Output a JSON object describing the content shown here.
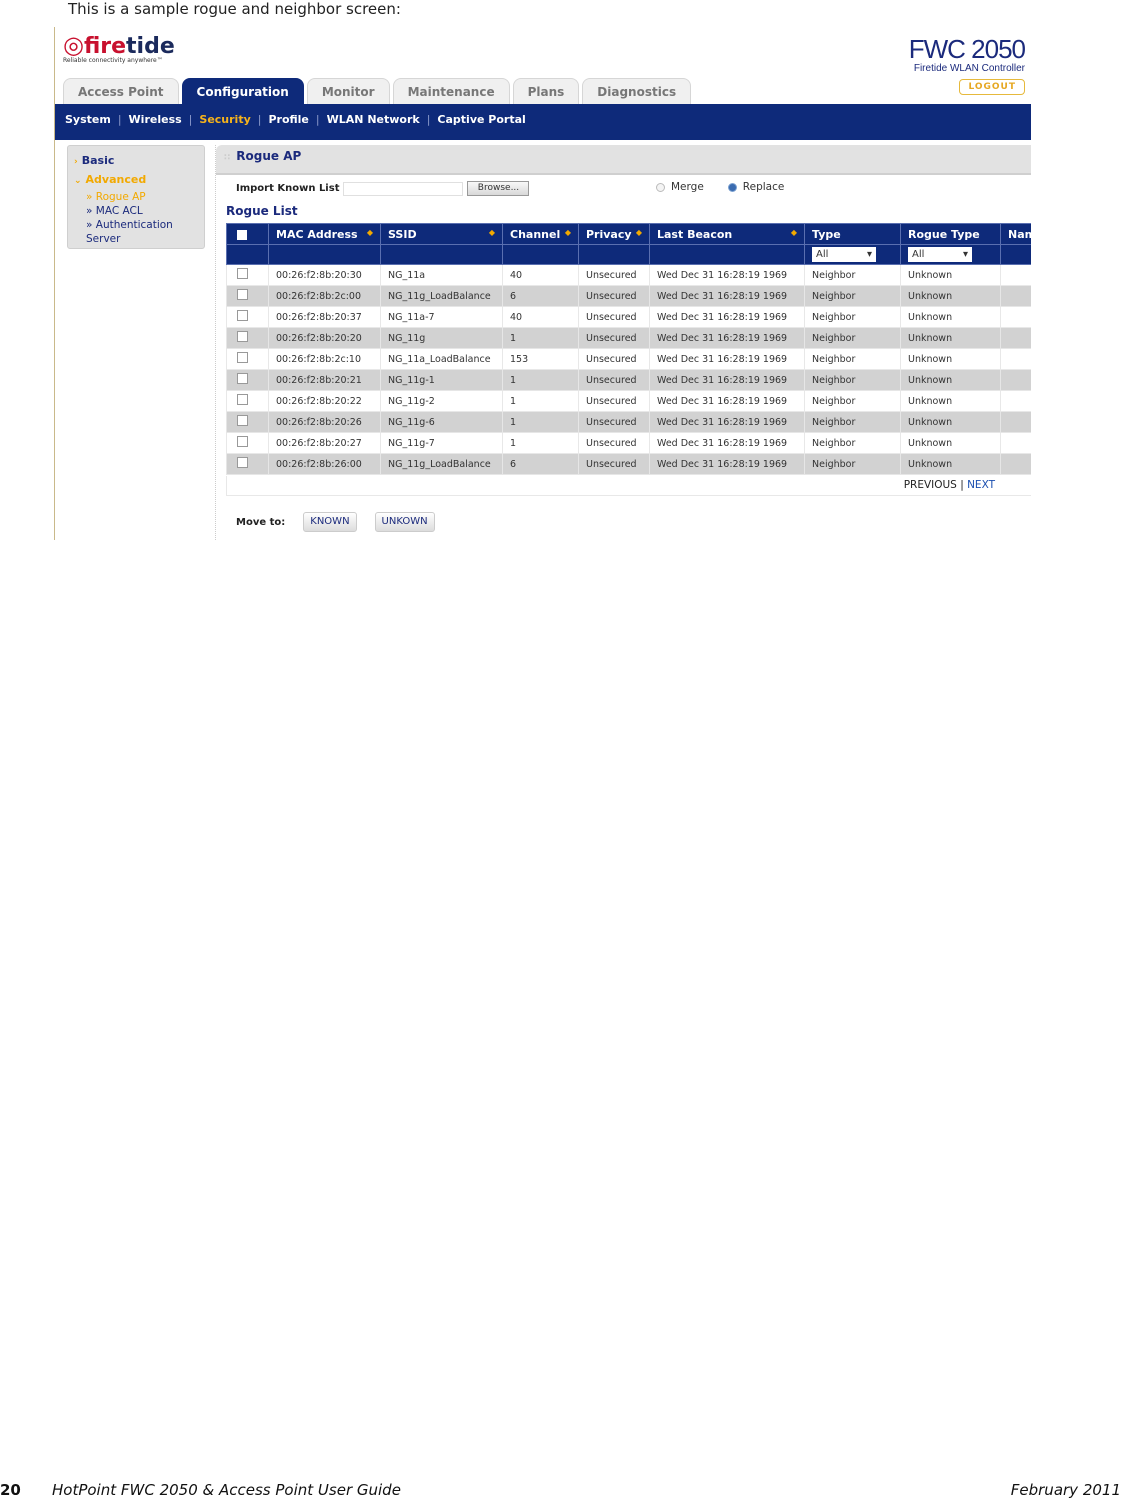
{
  "intro_text": "This is a sample rogue and neighbor screen:",
  "logo": {
    "mark": "୯",
    "fire": "fire",
    "tide": "tide",
    "tagline": "Reliable connectivity anywhere™"
  },
  "brand": {
    "model": "FWC 2050",
    "subtitle": "Firetide WLAN Controller",
    "logout_label": "LOGOUT"
  },
  "tabs": [
    {
      "label": "Access Point",
      "active": false
    },
    {
      "label": "Configuration",
      "active": true
    },
    {
      "label": "Monitor",
      "active": false
    },
    {
      "label": "Maintenance",
      "active": false
    },
    {
      "label": "Plans",
      "active": false
    },
    {
      "label": "Diagnostics",
      "active": false
    }
  ],
  "subnav": [
    "System",
    "Wireless",
    "Security",
    "Profile",
    "WLAN Network",
    "Captive Portal"
  ],
  "subnav_active": "Security",
  "sidebar": {
    "basic": "Basic",
    "advanced": "Advanced",
    "items": [
      "» Rogue AP",
      "» MAC ACL",
      "» Authentication Server"
    ]
  },
  "panel": {
    "title": "Rogue AP",
    "import_label": "Import Known List",
    "import_value": "",
    "browse_label": "Browse...",
    "merge_label": "Merge",
    "replace_label": "Replace",
    "selected_mode": "Replace",
    "list_title": "Rogue List"
  },
  "table": {
    "headers": [
      "",
      "MAC Address",
      "SSID",
      "Channel",
      "Privacy",
      "Last Beacon",
      "Type",
      "Rogue Type",
      "Nam"
    ],
    "type_filter": "All",
    "rogue_type_filter": "All",
    "rows": [
      {
        "mac": "00:26:f2:8b:20:30",
        "ssid": "NG_11a",
        "channel": "40",
        "privacy": "Unsecured",
        "beacon": "Wed Dec 31 16:28:19 1969",
        "type": "Neighbor",
        "rogue": "Unknown"
      },
      {
        "mac": "00:26:f2:8b:2c:00",
        "ssid": "NG_11g_LoadBalance",
        "channel": "6",
        "privacy": "Unsecured",
        "beacon": "Wed Dec 31 16:28:19 1969",
        "type": "Neighbor",
        "rogue": "Unknown"
      },
      {
        "mac": "00:26:f2:8b:20:37",
        "ssid": "NG_11a-7",
        "channel": "40",
        "privacy": "Unsecured",
        "beacon": "Wed Dec 31 16:28:19 1969",
        "type": "Neighbor",
        "rogue": "Unknown"
      },
      {
        "mac": "00:26:f2:8b:20:20",
        "ssid": "NG_11g",
        "channel": "1",
        "privacy": "Unsecured",
        "beacon": "Wed Dec 31 16:28:19 1969",
        "type": "Neighbor",
        "rogue": "Unknown"
      },
      {
        "mac": "00:26:f2:8b:2c:10",
        "ssid": "NG_11a_LoadBalance",
        "channel": "153",
        "privacy": "Unsecured",
        "beacon": "Wed Dec 31 16:28:19 1969",
        "type": "Neighbor",
        "rogue": "Unknown"
      },
      {
        "mac": "00:26:f2:8b:20:21",
        "ssid": "NG_11g-1",
        "channel": "1",
        "privacy": "Unsecured",
        "beacon": "Wed Dec 31 16:28:19 1969",
        "type": "Neighbor",
        "rogue": "Unknown"
      },
      {
        "mac": "00:26:f2:8b:20:22",
        "ssid": "NG_11g-2",
        "channel": "1",
        "privacy": "Unsecured",
        "beacon": "Wed Dec 31 16:28:19 1969",
        "type": "Neighbor",
        "rogue": "Unknown"
      },
      {
        "mac": "00:26:f2:8b:20:26",
        "ssid": "NG_11g-6",
        "channel": "1",
        "privacy": "Unsecured",
        "beacon": "Wed Dec 31 16:28:19 1969",
        "type": "Neighbor",
        "rogue": "Unknown"
      },
      {
        "mac": "00:26:f2:8b:20:27",
        "ssid": "NG_11g-7",
        "channel": "1",
        "privacy": "Unsecured",
        "beacon": "Wed Dec 31 16:28:19 1969",
        "type": "Neighbor",
        "rogue": "Unknown"
      },
      {
        "mac": "00:26:f2:8b:26:00",
        "ssid": "NG_11g_LoadBalance",
        "channel": "6",
        "privacy": "Unsecured",
        "beacon": "Wed Dec 31 16:28:19 1969",
        "type": "Neighbor",
        "rogue": "Unknown"
      }
    ]
  },
  "pager": {
    "previous": "PREVIOUS",
    "separator": "|",
    "next": "NEXT"
  },
  "move": {
    "label": "Move to:",
    "known": "KNOWN",
    "unknown": "UNKOWN"
  },
  "footer": {
    "page_number": "20",
    "guide_title": "HotPoint FWC 2050 & Access Point User Guide",
    "date": "February 2011"
  },
  "colors": {
    "nav_blue": "#0e2a7a",
    "accent_orange": "#f2a900",
    "brand_red": "#c8102e"
  }
}
